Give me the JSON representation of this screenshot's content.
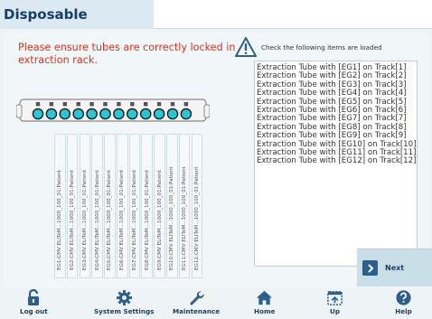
{
  "header": {
    "title": "Disposable"
  },
  "warning": {
    "text": "Please ensure tubes are correctly locked in extraction rack."
  },
  "info": {
    "text": "Check the following items are loaded"
  },
  "checklist": [
    "Extraction Tube with [EG1] on Track[1]",
    "Extraction Tube with [EG2] on Track[2]",
    "Extraction Tube with [EG3] on Track[3]",
    "Extraction Tube with [EG4] on Track[4]",
    "Extraction Tube with [EG5] on Track[5]",
    "Extraction Tube with [EG6] on Track[6]",
    "Extraction Tube with [EG7] on Track[7]",
    "Extraction Tube with [EG8] on Track[8]",
    "Extraction Tube with [EG9] on Track[9]",
    "Extraction Tube with [EG10] on Track[10]",
    "Extraction Tube with [EG11] on Track[11]",
    "Extraction Tube with [EG12] on Track[12]"
  ],
  "tube_labels": [
    "EG1:CMV ELITeM...1000_100_01:Patient",
    "EG2:CMV ELITeM...1000_100_01:Patient",
    "EG3:CMV ELITeM...1000_100_01:Patient",
    "EG4:CMV ELITeM...1000_100_01:Patient",
    "EG5:CMV ELITeM...1000_100_01:Patient",
    "EG6:CMV ELITeM...1000_100_01:Patient",
    "EG7:CMV ELITeM...1000_100_01:Patient",
    "EG8:CMV ELITeM...1000_100_01:Patient",
    "EG9:CMV ELITeM...1000_100_01:Patient",
    "EG10:CMV ELITeM...1000_100_01:Patient",
    "EG11:CMV ELITeM...1000_100_01:Patient",
    "EG12:CMV ELITeM...1000_100_01:Patient"
  ],
  "rack": {
    "positions": 12,
    "tube_color": "#23c9d6"
  },
  "next_button": {
    "label": "Next"
  },
  "nav": {
    "logout": "Log out",
    "system_settings": "System Settings",
    "maintenance": "Maintenance",
    "home": "Home",
    "up": "Up",
    "help": "Help"
  },
  "icons": {
    "info": "warning-triangle-icon",
    "next": "chevron-right-icon",
    "logout": "padlock-icon",
    "system_settings": "gear-icon",
    "maintenance": "wrench-icon",
    "home": "house-icon",
    "up": "calendar-up-icon",
    "help": "question-mark-icon"
  },
  "colors": {
    "accent": "#1f3f63",
    "warning": "#e0301e",
    "next_button_bg": "#c8dfe7",
    "title_tab_bg": "#dbe9f3"
  }
}
